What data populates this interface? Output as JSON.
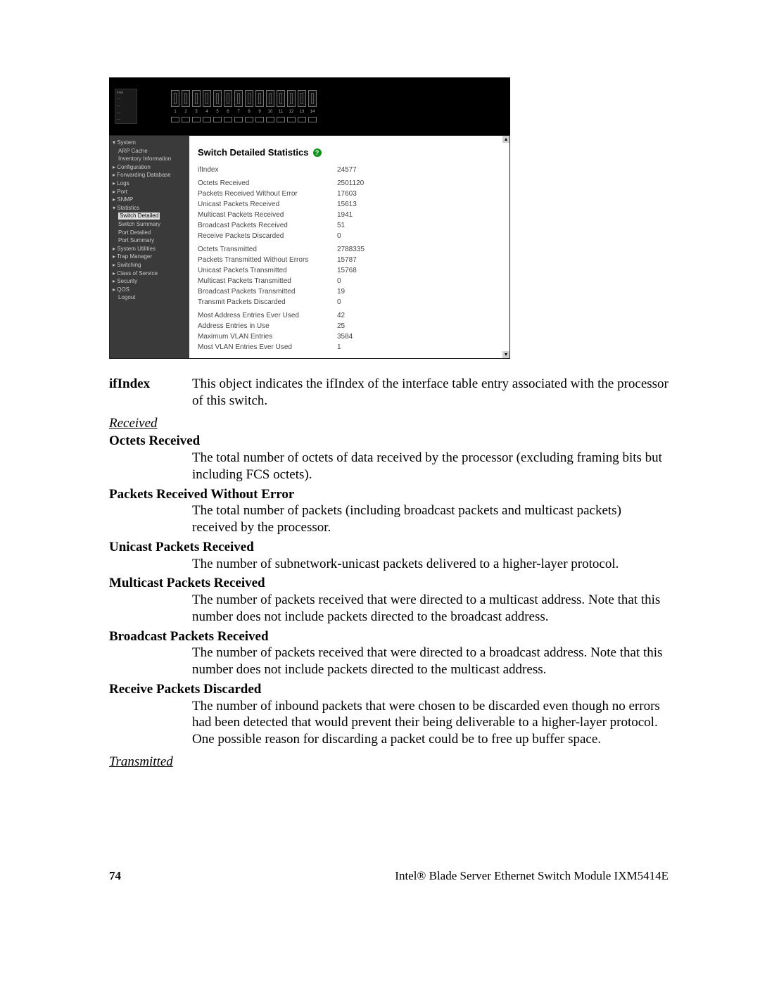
{
  "screenshot": {
    "nav": [
      {
        "label": "System",
        "lvl": 0,
        "marker": "▾"
      },
      {
        "label": "ARP Cache",
        "lvl": 1
      },
      {
        "label": "Inventory Information",
        "lvl": 1
      },
      {
        "label": "Configuration",
        "lvl": 0,
        "marker": "▸"
      },
      {
        "label": "Forwarding Database",
        "lvl": 0,
        "marker": "▸"
      },
      {
        "label": "Logs",
        "lvl": 0,
        "marker": "▸"
      },
      {
        "label": "Port",
        "lvl": 0,
        "marker": "▸"
      },
      {
        "label": "SNMP",
        "lvl": 0,
        "marker": "▸"
      },
      {
        "label": "Statistics",
        "lvl": 0,
        "marker": "▾"
      },
      {
        "label": "Switch Detailed",
        "lvl": 1,
        "selected": true
      },
      {
        "label": "Switch Summary",
        "lvl": 1
      },
      {
        "label": "Port Detailed",
        "lvl": 1
      },
      {
        "label": "Port Summary",
        "lvl": 1
      },
      {
        "label": "System Utilities",
        "lvl": 0,
        "marker": "▸"
      },
      {
        "label": "Trap Manager",
        "lvl": 0,
        "marker": "▸"
      },
      {
        "label": "Switching",
        "lvl": 0,
        "marker": "▸"
      },
      {
        "label": "Class of Service",
        "lvl": 0,
        "marker": "▸"
      },
      {
        "label": "Security",
        "lvl": 0,
        "marker": "▸"
      },
      {
        "label": "QOS",
        "lvl": 0,
        "marker": "▸"
      },
      {
        "label": "Logout",
        "lvl": 1
      }
    ],
    "title": "Switch Detailed Statistics",
    "help": "?",
    "stats": [
      {
        "k": "ifIndex",
        "v": "24577"
      },
      {
        "gap": true
      },
      {
        "k": "Octets Received",
        "v": "2501120"
      },
      {
        "k": "Packets Received Without Error",
        "v": "17603"
      },
      {
        "k": "Unicast Packets Received",
        "v": "15613"
      },
      {
        "k": "Multicast Packets Received",
        "v": "1941"
      },
      {
        "k": "Broadcast Packets Received",
        "v": "51"
      },
      {
        "k": "Receive Packets Discarded",
        "v": "0"
      },
      {
        "gap": true
      },
      {
        "k": "Octets Transmitted",
        "v": "2788335"
      },
      {
        "k": "Packets Transmitted Without Errors",
        "v": "15787"
      },
      {
        "k": "Unicast Packets Transmitted",
        "v": "15768"
      },
      {
        "k": "Multicast Packets Transmitted",
        "v": "0"
      },
      {
        "k": "Broadcast Packets Transmitted",
        "v": "19"
      },
      {
        "k": "Transmit Packets Discarded",
        "v": "0"
      },
      {
        "gap": true
      },
      {
        "k": "Most Address Entries Ever Used",
        "v": "42"
      },
      {
        "k": "Address Entries in Use",
        "v": "25"
      },
      {
        "k": "Maximum VLAN Entries",
        "v": "3584"
      },
      {
        "k": "Most VLAN Entries Ever Used",
        "v": "1"
      }
    ],
    "portnums": [
      "1",
      "2",
      "3",
      "4",
      "5",
      "6",
      "7",
      "8",
      "9",
      "10",
      "11",
      "12",
      "13",
      "14"
    ]
  },
  "doc": {
    "ifindex": {
      "term": "ifIndex",
      "desc": "This object indicates the ifIndex of the interface table entry associated with the processor of this switch."
    },
    "received_heading": "Received",
    "received": [
      {
        "term": "Octets Received",
        "desc": "The total number of octets of data received by the processor (excluding framing bits but including FCS octets)."
      },
      {
        "term": "Packets Received Without Error",
        "desc": "The total number of packets (including broadcast packets and multicast packets) received by the processor."
      },
      {
        "term": "Unicast Packets Received",
        "desc": "The number of subnetwork-unicast packets delivered to a higher-layer protocol."
      },
      {
        "term": "Multicast Packets Received",
        "desc": "The number of packets received that were directed to a multicast address. Note that this number does not include packets directed to the broadcast address."
      },
      {
        "term": "Broadcast Packets Received",
        "desc": "The number of packets received that were directed to a broadcast address. Note that this number does not include packets directed to the multicast address."
      },
      {
        "term": "Receive Packets Discarded",
        "desc": "The number of inbound packets that were chosen to be discarded even though no errors had been detected that would prevent their being deliverable to a higher-layer protocol. One possible reason for discarding a packet could be to free up buffer space."
      }
    ],
    "transmitted_heading": "Transmitted"
  },
  "footer": {
    "page": "74",
    "title": "Intel® Blade Server Ethernet Switch Module IXM5414E"
  }
}
